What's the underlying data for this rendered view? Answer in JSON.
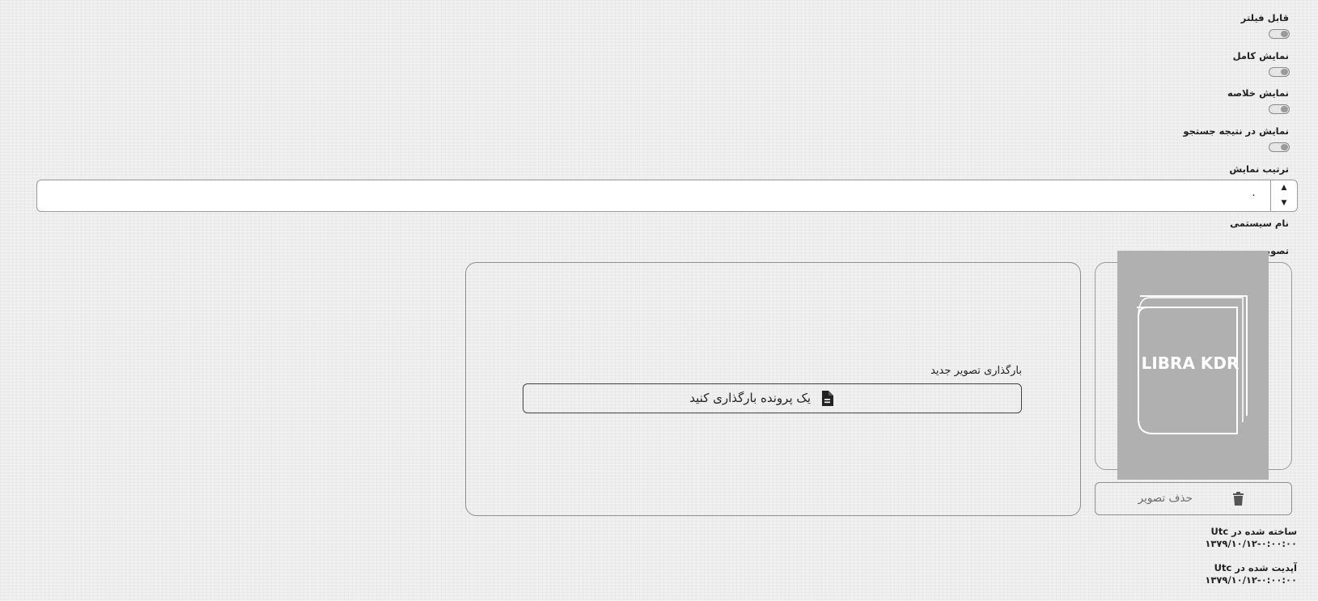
{
  "flags": [
    {
      "label": "قابل فیلتر"
    },
    {
      "label": "نمایش کامل"
    },
    {
      "label": "نمایش خلاصه"
    },
    {
      "label": "نمایش در نتیجه جستجو"
    }
  ],
  "display_order": {
    "label": "ترتیب نمایش",
    "value": "۰",
    "step_up": "▲",
    "step_down": "▼"
  },
  "system_name": {
    "label": "نام سیستمی"
  },
  "image": {
    "label": "تصویر",
    "preview_text": "LIBRA KDR",
    "upload_title": "بارگذاری تصویر جدید",
    "upload_button": "یک پرونده بارگذاری کنید",
    "delete_button": "حذف تصویر"
  },
  "created": {
    "label": "ساخته شده در Utc",
    "value": "۱۳۷۹/۱۰/۱۲-۰:۰۰:۰۰"
  },
  "updated": {
    "label": "آپدیت شده در Utc",
    "value": "۱۳۷۹/۱۰/۱۲-۰:۰۰:۰۰"
  }
}
